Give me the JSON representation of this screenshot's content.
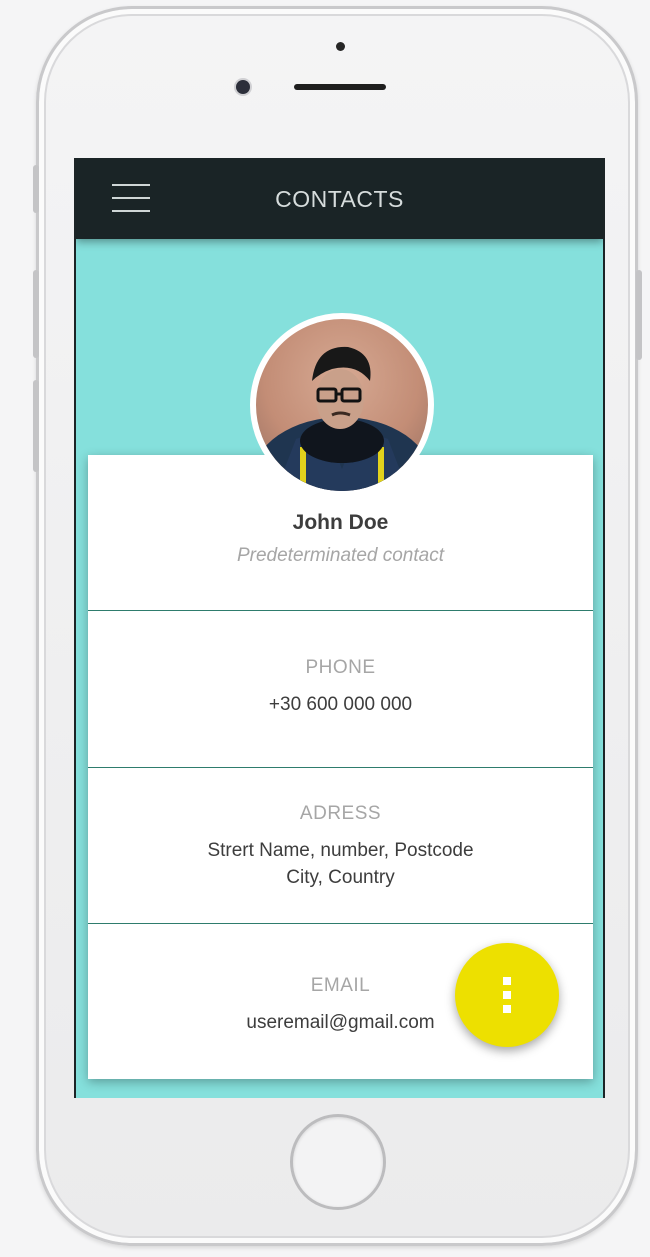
{
  "app_bar": {
    "title": "CONTACTS",
    "menu_icon": "hamburger-menu-icon"
  },
  "profile": {
    "name": "John Doe",
    "subtitle": "Predeterminated contact"
  },
  "fields": [
    {
      "label": "PHONE",
      "value": "+30 600 000 000"
    },
    {
      "label": "ADRESS",
      "value_line1": "Strert Name, number, Postcode",
      "value_line2": "City, Country"
    },
    {
      "label": "EMAIL",
      "value": "useremail@gmail.com"
    }
  ],
  "fab": {
    "icon": "more-vertical-icon"
  },
  "colors": {
    "app_bar": "#1a2426",
    "header_band": "#85e0dc",
    "fab": "#ede000",
    "divider": "#2e7c6d"
  }
}
